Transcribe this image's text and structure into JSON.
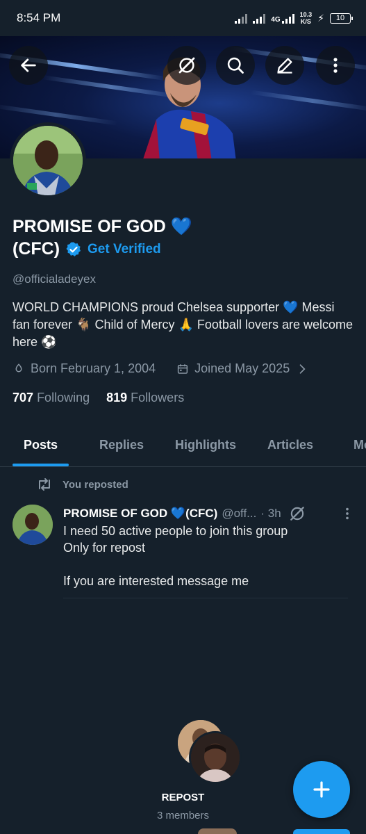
{
  "status_bar": {
    "time": "8:54 PM",
    "network": "4G",
    "speed_value": "10.3",
    "speed_unit": "K/S",
    "battery": "10"
  },
  "toolbar": {
    "icons": [
      "back-arrow-icon",
      "grok-icon",
      "search-icon",
      "edit-icon",
      "more-vertical-icon"
    ]
  },
  "profile": {
    "name_line1": "PROMISE OF GOD 💙",
    "name_line2": "(CFC)",
    "get_verified_label": "Get Verified",
    "handle": "@officialadeyex",
    "bio": "WORLD CHAMPIONS proud Chelsea supporter 💙 Messi fan forever 🐐 Child of Mercy 🙏 Football lovers are welcome here ⚽",
    "born": "Born February 1, 2004",
    "joined": "Joined May 2025",
    "following_count": "707",
    "following_label": "Following",
    "followers_count": "819",
    "followers_label": "Followers"
  },
  "tabs": [
    {
      "label": "Posts",
      "active": true
    },
    {
      "label": "Replies",
      "active": false
    },
    {
      "label": "Highlights",
      "active": false
    },
    {
      "label": "Articles",
      "active": false
    },
    {
      "label": "Me",
      "active": false
    }
  ],
  "post": {
    "repost_label": "You reposted",
    "author_name": "PROMISE OF GOD 💙(CFC)",
    "author_handle": "@off...",
    "time": "· 3h",
    "lines": [
      "I need 50 active people to join this group",
      "Only for repost",
      "",
      "If you are interested message me"
    ]
  },
  "community": {
    "name": "REPOST",
    "members": "3 members"
  },
  "colors": {
    "background": "#15202b",
    "accent": "#1d9bf0",
    "secondary_text": "#8b98a5"
  }
}
